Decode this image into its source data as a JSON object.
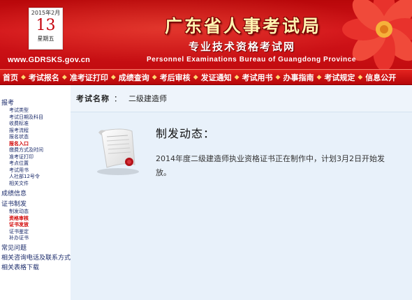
{
  "header": {
    "calendar": {
      "month": "2015年2月",
      "day": "13",
      "weekday": "星期五"
    },
    "site_url": "www.GDRSKS.gov.cn",
    "title": "广东省人事考试局",
    "subtitle": "专业技术资格考试网",
    "subtitle_en": "Personnel Examinations Bureau of Guangdong Province"
  },
  "nav": {
    "items": [
      "首页",
      "考试报名",
      "准考证打印",
      "成绩查询",
      "考后审核",
      "发证通知",
      "考试用书",
      "办事指南",
      "考试规定",
      "信息公开"
    ],
    "separator": "◆"
  },
  "sidebar": {
    "baokao": "报考",
    "baokao_items": [
      "考试类型",
      "考试日期及科目",
      "收费标准",
      "报考流程",
      "报名状态",
      "报名入口",
      "缴费方式及时间",
      "准考证打印",
      "考点位置",
      "考试用书",
      "人社部12号令",
      "相关文件"
    ],
    "chengji": "成绩信息",
    "zhengshu": "证书制发",
    "zhengshu_items": [
      "制发动态",
      "资格审核",
      "证书发放",
      "证书鉴定",
      "补办证书"
    ],
    "faq": "常见问题",
    "contact": "相关咨询电话及联系方式",
    "forms": "相关表格下载"
  },
  "main": {
    "exam_label": "考试名称",
    "exam_colon": "：",
    "exam_value": "二级建造师",
    "title": "制发动态：",
    "body": "2014年度二级建造师执业资格证书正在制作中，计划3月2日开始发放。"
  },
  "colors": {
    "header_red": "#c20c10",
    "nav_red": "#d3141a",
    "title_yellow": "#fff3b0",
    "link_blue": "#1a2a6a",
    "active_red": "#d10000",
    "main_bg": "#e8f1fa"
  },
  "icons": {
    "document": "scroll-document-icon",
    "flower": "red-flower-icon"
  }
}
